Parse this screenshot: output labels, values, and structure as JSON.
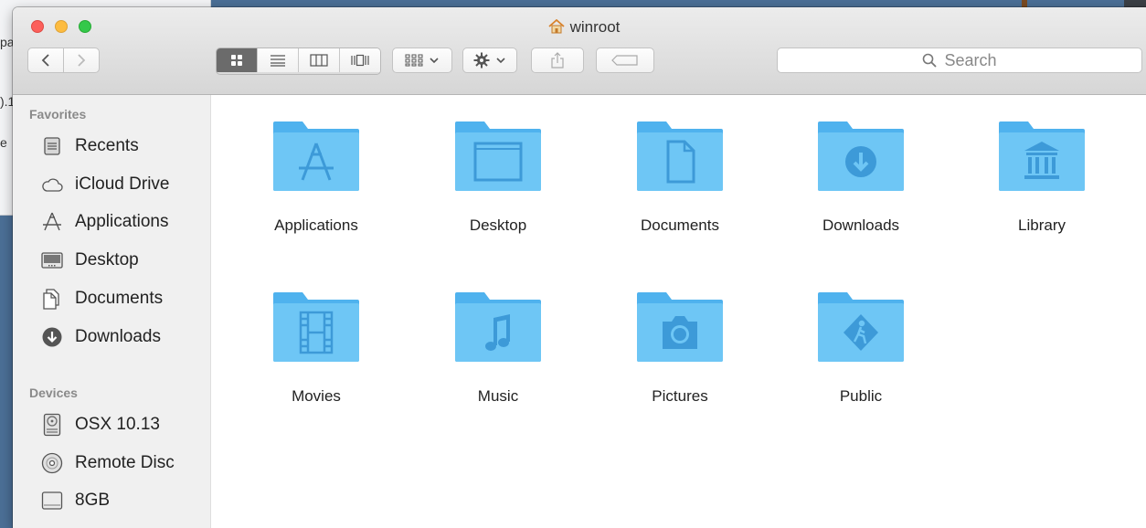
{
  "window": {
    "title": "winroot"
  },
  "toolbar": {
    "search_placeholder": "Search"
  },
  "background_partial_text": [
    "pa",
    ").1",
    "e"
  ],
  "sidebar": {
    "favorites_title": "Favorites",
    "favorites": [
      {
        "label": "Recents",
        "icon": "recents-icon"
      },
      {
        "label": "iCloud Drive",
        "icon": "cloud-icon"
      },
      {
        "label": "Applications",
        "icon": "applications-icon"
      },
      {
        "label": "Desktop",
        "icon": "desktop-icon"
      },
      {
        "label": "Documents",
        "icon": "documents-icon"
      },
      {
        "label": "Downloads",
        "icon": "downloads-icon"
      }
    ],
    "devices_title": "Devices",
    "devices": [
      {
        "label": "OSX 10.13",
        "icon": "hard-disk-icon"
      },
      {
        "label": "Remote Disc",
        "icon": "disc-icon"
      },
      {
        "label": "8GB",
        "icon": "drive-icon"
      }
    ]
  },
  "files": [
    {
      "label": "Applications",
      "icon": "applications-folder-icon"
    },
    {
      "label": "Desktop",
      "icon": "desktop-folder-icon"
    },
    {
      "label": "Documents",
      "icon": "documents-folder-icon"
    },
    {
      "label": "Downloads",
      "icon": "downloads-folder-icon"
    },
    {
      "label": "Library",
      "icon": "library-folder-icon"
    },
    {
      "label": "Movies",
      "icon": "movies-folder-icon"
    },
    {
      "label": "Music",
      "icon": "music-folder-icon"
    },
    {
      "label": "Pictures",
      "icon": "pictures-folder-icon"
    },
    {
      "label": "Public",
      "icon": "public-folder-icon"
    }
  ],
  "colors": {
    "folder": "#6ec6f5",
    "folder_dark": "#4fb2ee",
    "folder_glyph": "#3d9ad8"
  }
}
